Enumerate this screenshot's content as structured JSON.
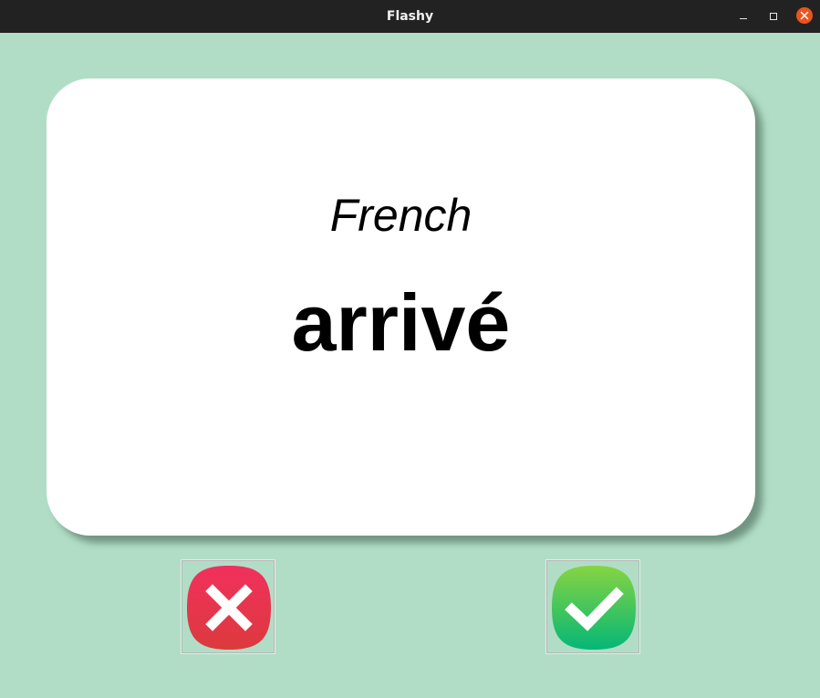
{
  "window": {
    "title": "Flashy",
    "controls": {
      "minimize_icon": "minimize-icon",
      "maximize_icon": "maximize-icon",
      "close_icon": "close-icon"
    }
  },
  "card": {
    "language": "French",
    "word": "arrivé"
  },
  "buttons": {
    "wrong": {
      "icon": "cross-icon",
      "color": "#e8354e"
    },
    "right": {
      "icon": "checkmark-icon",
      "color": "#2ec25e"
    }
  },
  "colors": {
    "background": "#b1ddc6",
    "titlebar": "#222222",
    "close_accent": "#e95420",
    "card": "#ffffff"
  }
}
